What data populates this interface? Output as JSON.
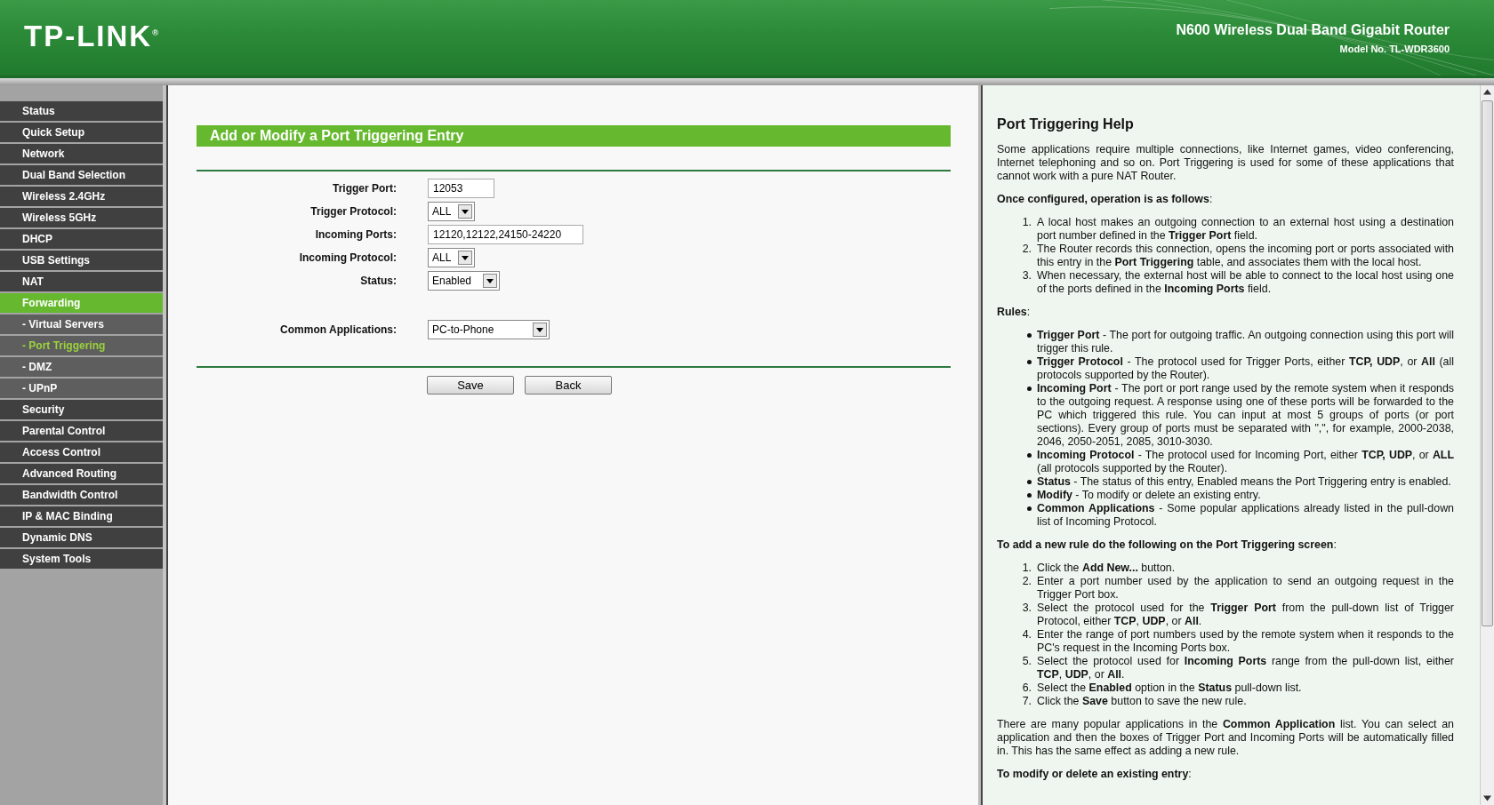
{
  "header": {
    "logo": "TP-LINK$^{®}$",
    "product": "N600 Wireless Dual Band Gigabit Router",
    "model": "Model No. TL-WDR3600"
  },
  "sidebar": {
    "items": [
      {
        "label": "Status",
        "kind": "main",
        "expanded": false,
        "selected": false
      },
      {
        "label": "Quick Setup",
        "kind": "main",
        "expanded": false,
        "selected": false
      },
      {
        "label": "Network",
        "kind": "main",
        "expanded": false,
        "selected": false
      },
      {
        "label": "Dual Band Selection",
        "kind": "main",
        "expanded": false,
        "selected": false
      },
      {
        "label": "Wireless 2.4GHz",
        "kind": "main",
        "expanded": false,
        "selected": false
      },
      {
        "label": "Wireless 5GHz",
        "kind": "main",
        "expanded": false,
        "selected": false
      },
      {
        "label": "DHCP",
        "kind": "main",
        "expanded": false,
        "selected": false
      },
      {
        "label": "USB Settings",
        "kind": "main",
        "expanded": false,
        "selected": false
      },
      {
        "label": "NAT",
        "kind": "main",
        "expanded": false,
        "selected": false
      },
      {
        "label": "Forwarding",
        "kind": "main",
        "expanded": true,
        "selected": false
      },
      {
        "label": "- Virtual Servers",
        "kind": "sub",
        "expanded": false,
        "selected": false
      },
      {
        "label": "- Port Triggering",
        "kind": "sub",
        "expanded": false,
        "selected": true
      },
      {
        "label": "- DMZ",
        "kind": "sub",
        "expanded": false,
        "selected": false
      },
      {
        "label": "- UPnP",
        "kind": "sub",
        "expanded": false,
        "selected": false
      },
      {
        "label": "Security",
        "kind": "main",
        "expanded": false,
        "selected": false
      },
      {
        "label": "Parental Control",
        "kind": "main",
        "expanded": false,
        "selected": false
      },
      {
        "label": "Access Control",
        "kind": "main",
        "expanded": false,
        "selected": false
      },
      {
        "label": "Advanced Routing",
        "kind": "main",
        "expanded": false,
        "selected": false
      },
      {
        "label": "Bandwidth Control",
        "kind": "main",
        "expanded": false,
        "selected": false
      },
      {
        "label": "IP & MAC Binding",
        "kind": "main",
        "expanded": false,
        "selected": false
      },
      {
        "label": "Dynamic DNS",
        "kind": "main",
        "expanded": false,
        "selected": false
      },
      {
        "label": "System Tools",
        "kind": "main",
        "expanded": false,
        "selected": false
      }
    ]
  },
  "form": {
    "title": "Add or Modify a Port Triggering Entry",
    "fields": [
      {
        "label": "Trigger Port:",
        "kind": "text",
        "value": "12053"
      },
      {
        "label": "Trigger Protocol:",
        "kind": "select",
        "value": "ALL"
      },
      {
        "label": "Incoming Ports:",
        "kind": "text",
        "value": "12120,12122,24150-24220"
      },
      {
        "label": "Incoming Protocol:",
        "kind": "select",
        "value": "ALL"
      },
      {
        "label": "Status:",
        "kind": "select",
        "value": "Enabled"
      }
    ],
    "common": {
      "label": "Common Applications:",
      "kind": "select",
      "value": "PC-to-Phone"
    },
    "buttons": [
      "Save",
      "Back"
    ]
  },
  "help": {
    "title": "Port Triggering Help",
    "blocks": [
      {
        "kind": "paragraph",
        "text": "Some applications require multiple connections, like Internet games, video conferencing, Internet telephoning and so on. Port Triggering is used for some of these applications that cannot work with a pure NAT Router."
      },
      {
        "kind": "paragraph",
        "text": "**Once configured, operation is as follows**:"
      },
      {
        "kind": "ordered",
        "items": [
          {
            "number": "1.",
            "text": "A local host makes an outgoing connection to an external host using a destination port number defined in the **Trigger Port** field."
          },
          {
            "number": "2.",
            "text": "The Router records this connection, opens the incoming port or ports associated with this entry in the **Port Triggering** table, and associates them with the local host."
          },
          {
            "number": "3.",
            "text": "When necessary, the external host will be able to connect to the local host using one of the ports defined in the **Incoming Ports** field."
          }
        ]
      },
      {
        "kind": "paragraph",
        "text": "**Rules**:"
      },
      {
        "kind": "bullets",
        "items": [
          "**Trigger Port** - The port for outgoing traffic. An outgoing connection using this port will trigger this rule.",
          "**Trigger Protocol** - The protocol used for Trigger Ports, either **TCP, UDP**, or **All** (all protocols supported by the Router).",
          "**Incoming Port** - The port or port range used by the remote system when it responds to the outgoing request. A response using one of these ports will be forwarded to the PC which triggered this rule. You can input at most 5 groups of ports (or port sections). Every group of ports must be separated with \",\", for example, 2000-2038, 2046, 2050-2051, 2085, 3010-3030.",
          "**Incoming Protocol** - The protocol used for Incoming Port, either **TCP, UDP**, or **ALL** (all protocols supported by the Router).",
          "**Status** - The status of this entry, Enabled means the Port Triggering entry is enabled.",
          "**Modify** - To modify or delete an existing entry.",
          "**Common Applications** - Some popular applications already listed in the pull-down list of Incoming Protocol."
        ]
      },
      {
        "kind": "paragraph",
        "text": "**To add a new rule do the following on the Port Triggering screen**:"
      },
      {
        "kind": "ordered",
        "items": [
          {
            "number": "1.",
            "text": "Click the **Add New...** button."
          },
          {
            "number": "2.",
            "text": "Enter a port number used by the application to send an outgoing request in the Trigger Port box."
          },
          {
            "number": "3.",
            "text": "Select the protocol used for the **Trigger Port** from the pull-down list of Trigger Protocol, either **TCP**, **UDP**, or **All**."
          },
          {
            "number": "4.",
            "text": "Enter the range of port numbers used by the remote system when it responds to the PC's request in the Incoming Ports box."
          },
          {
            "number": "5.",
            "text": "Select the protocol used for **Incoming Ports** range from the pull-down list, either **TCP**, **UDP**, or **All**."
          },
          {
            "number": "6.",
            "text": "Select the **Enabled** option in the **Status** pull-down list."
          },
          {
            "number": "7.",
            "text": "Click the **Save** button to save the new rule."
          }
        ]
      },
      {
        "kind": "paragraph",
        "text": "There are many popular applications in the **Common Application** list. You can select an application and then the boxes of Trigger Port and Incoming Ports will be automatically filled in. This has the same effect as adding a new rule."
      },
      {
        "kind": "paragraph",
        "text": "**To modify or delete an existing entry**:"
      }
    ]
  }
}
